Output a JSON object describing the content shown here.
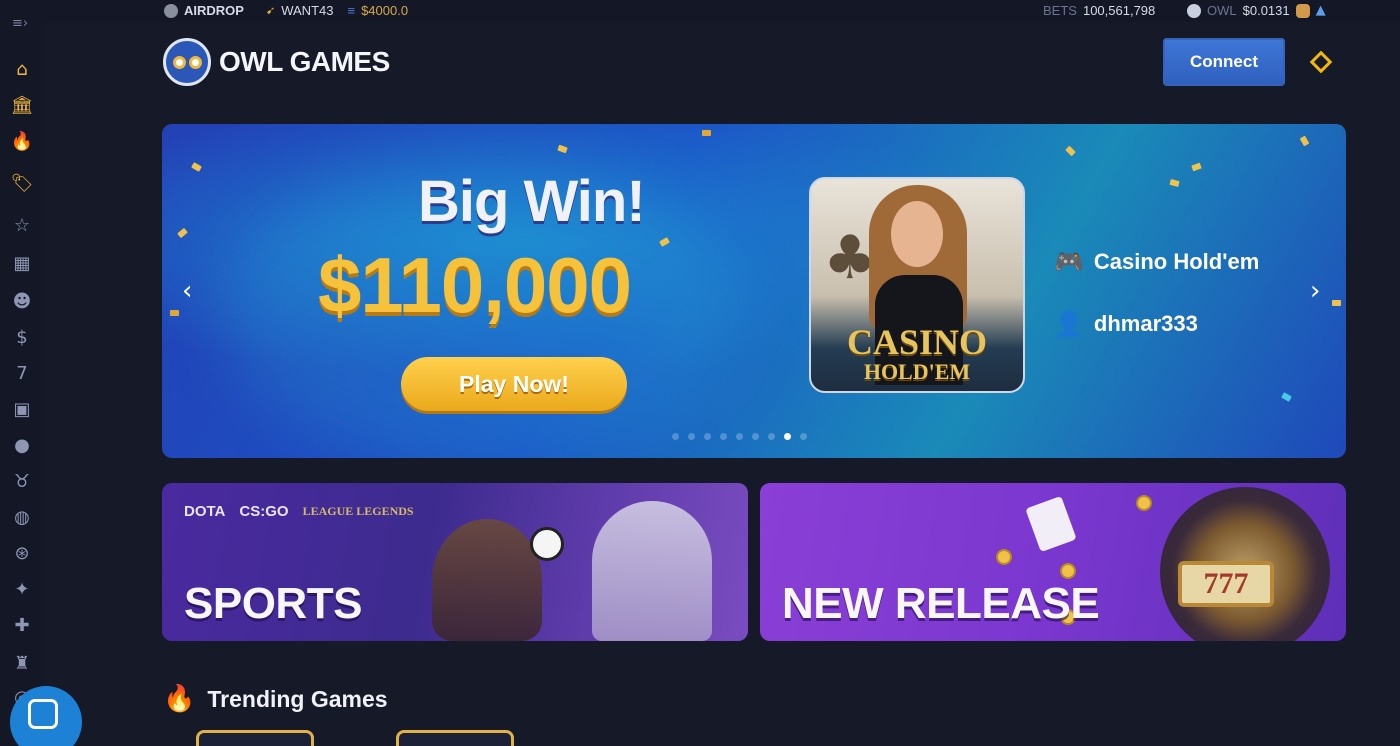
{
  "topbar": {
    "airdrop_label": "AIRDROP",
    "want_label": "WANT43",
    "want_value": "$4000.0",
    "bets_label": "BETS",
    "bets_value": "100,561,798",
    "owl_label": "OWL",
    "owl_value": "$0.0131"
  },
  "sidebar": {
    "items": [
      {
        "name": "home-icon",
        "glyph": "⌂",
        "color": true
      },
      {
        "name": "bank-icon",
        "glyph": "🏛",
        "color": true
      },
      {
        "name": "fire-icon",
        "glyph": "🔥",
        "color": true
      },
      {
        "name": "tag-icon",
        "glyph": "🏷",
        "color": true
      },
      {
        "name": "star-icon",
        "glyph": "☆"
      },
      {
        "name": "grid-icon",
        "glyph": "▦"
      },
      {
        "name": "owl-icon",
        "glyph": "☻"
      },
      {
        "name": "money-bag-icon",
        "glyph": "$"
      },
      {
        "name": "slots-777-icon",
        "glyph": "7"
      },
      {
        "name": "live-icon",
        "glyph": "▣"
      },
      {
        "name": "ping-pong-icon",
        "glyph": "●"
      },
      {
        "name": "bull-icon",
        "glyph": "♉"
      },
      {
        "name": "gamepad-icon",
        "glyph": "◍"
      },
      {
        "name": "wheel-icon",
        "glyph": "⊛"
      },
      {
        "name": "magic-wand-icon",
        "glyph": "✦"
      },
      {
        "name": "puzzle-icon",
        "glyph": "✚"
      },
      {
        "name": "trophy-icon",
        "glyph": "♜"
      },
      {
        "name": "ball-icon",
        "glyph": "◎"
      }
    ]
  },
  "header": {
    "logo_text": "OWL GAMES",
    "connect_label": "Connect"
  },
  "hero": {
    "headline": "Big Win!",
    "amount": "$110,000",
    "cta_label": "Play Now!",
    "game_card_title": "CASINO",
    "game_card_subtitle": "HOLD'EM",
    "game_name": "Casino Hold'em",
    "player_name": "dhmar333",
    "slide_count": 9,
    "active_slide": 7
  },
  "categories": {
    "sports_label": "SPORTS",
    "new_release_label": "NEW RELEASE",
    "esports": [
      "DOTA",
      "CS:GO",
      "LEAGUE LEGENDS"
    ],
    "slot_text": "777"
  },
  "trending": {
    "title": "Trending Games"
  },
  "colors": {
    "accent_gold": "#f6c23b",
    "connect_blue": "#3f78d8",
    "page_bg": "#161a28"
  }
}
